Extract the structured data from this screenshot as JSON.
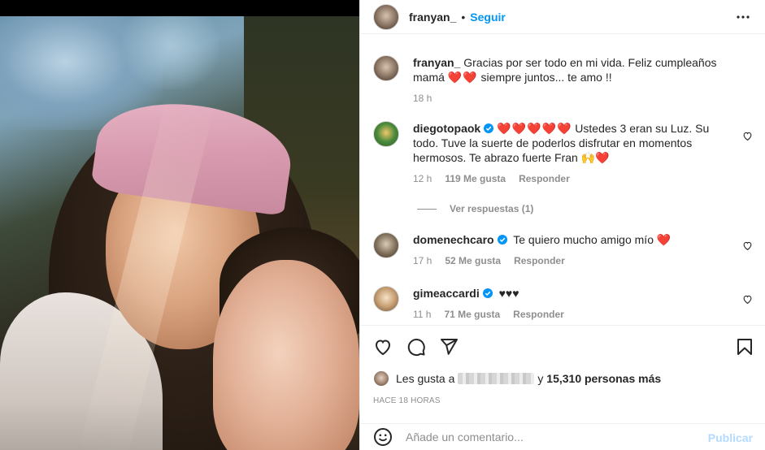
{
  "post": {
    "author": "franyan_",
    "separator": "•",
    "follow_label": "Seguir"
  },
  "caption": {
    "user": "franyan_",
    "text_1": " Gracias por ser todo en mi vida. Feliz cumpleaños mamá ",
    "hearts": "❤️❤️",
    "text_2": " siempre juntos... te amo !!",
    "time": "18 h"
  },
  "comments": [
    {
      "user": "diegotopaok",
      "hearts": "❤️❤️❤️❤️❤️",
      "text": " Ustedes 3 eran su Luz. Su todo. Tuve la suerte de poderlos disfrutar en momentos hermosos. Te abrazo fuerte Fran ",
      "end_emoji": "🙌❤️",
      "time": "12 h",
      "likes": "119 Me gusta",
      "reply": "Responder"
    },
    {
      "user": "domenechcaro",
      "text": " Te quiero mucho amigo mío ",
      "end_emoji": "❤️",
      "time": "17 h",
      "likes": "52 Me gusta",
      "reply": "Responder"
    },
    {
      "user": "gimeaccardi",
      "text": " ",
      "end_emoji": "♥♥♥",
      "time": "11 h",
      "likes": "71 Me gusta",
      "reply": "Responder"
    }
  ],
  "view_replies": "Ver respuestas (1)",
  "likes": {
    "prefix": "Les gusta a",
    "connector": "y",
    "count": "15,310 personas más"
  },
  "time_ago": "HACE 18 HORAS",
  "add_comment": {
    "placeholder": "Añade un comentario...",
    "publish_label": "Publicar"
  },
  "colors": {
    "accent": "#0095f6",
    "publish_disabled": "#b3dbff",
    "heart": "#ed1c24",
    "muted": "#8e8e8e"
  },
  "icons": [
    "more-options-icon",
    "verified-badge-icon",
    "heart-icon",
    "comment-icon",
    "share-icon",
    "bookmark-icon",
    "emoji-icon"
  ]
}
